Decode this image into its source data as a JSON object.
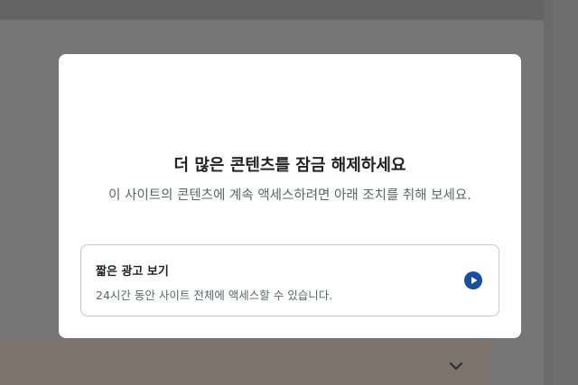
{
  "modal": {
    "title": "더 많은 콘텐츠를 잠금 해제하세요",
    "description": "이 사이트의 콘텐츠에 계속 액세스하려면 아래 조치를 취해 보세요.",
    "option": {
      "title": "짧은 광고 보기",
      "subtitle": "24시간 동안 사이트 전체에 액세스할 수 있습니다.",
      "icon": "play-circle-icon"
    }
  },
  "background": {
    "collapse_icon": "chevron-down-icon"
  },
  "colors": {
    "accent": "#1a4fa0",
    "overlay": "#707070",
    "modal_bg": "#ffffff"
  }
}
